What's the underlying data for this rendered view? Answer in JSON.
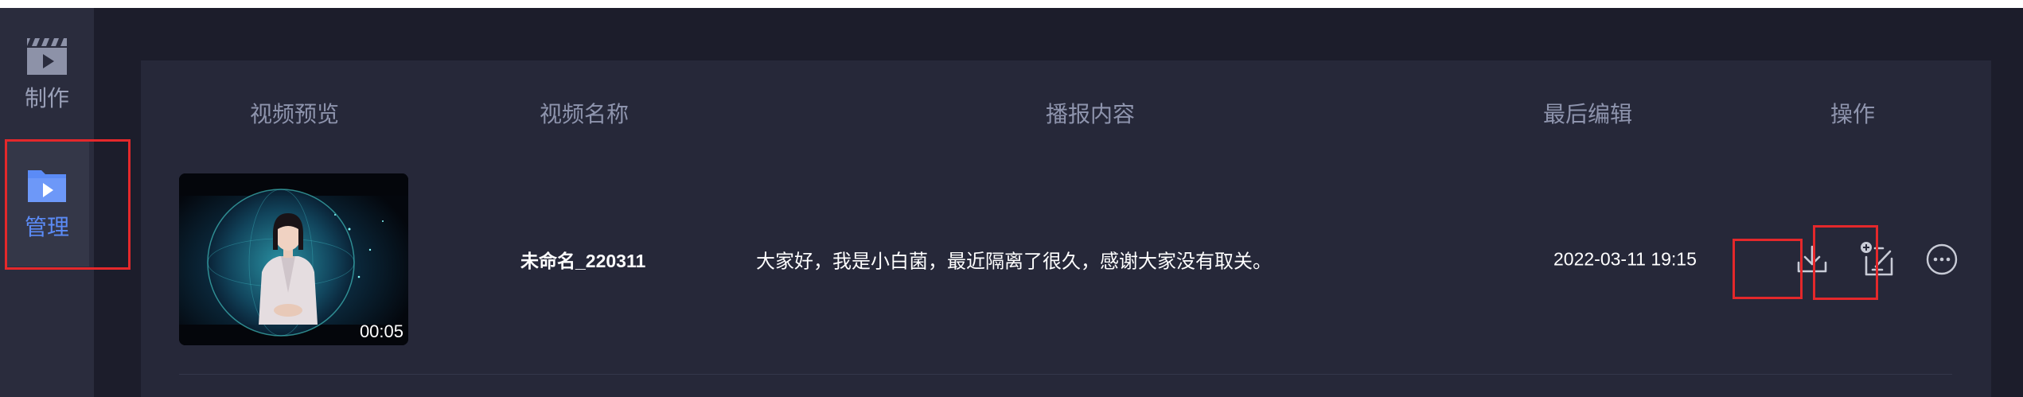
{
  "sidebar": {
    "items": [
      {
        "label": "制作",
        "icon": "clapperboard-video-icon"
      },
      {
        "label": "管理",
        "icon": "folder-play-icon",
        "active": true
      }
    ]
  },
  "table": {
    "headers": [
      "视频预览",
      "视频名称",
      "播报内容",
      "最后编辑",
      "操作"
    ],
    "rows": [
      {
        "duration": "00:05",
        "name": "未命名_220311",
        "content": "大家好，我是小白菌，最近隔离了很久，感谢大家没有取关。",
        "last_edited": "2022-03-11 19:15",
        "actions": [
          "download-icon",
          "add-edit-icon",
          "more-icon"
        ]
      }
    ]
  },
  "colors": {
    "background": "#1c1d2b",
    "sidebar": "#2a2c3d",
    "panel": "#262839",
    "accent": "#5b8bf6",
    "highlight": "#e4282b"
  }
}
